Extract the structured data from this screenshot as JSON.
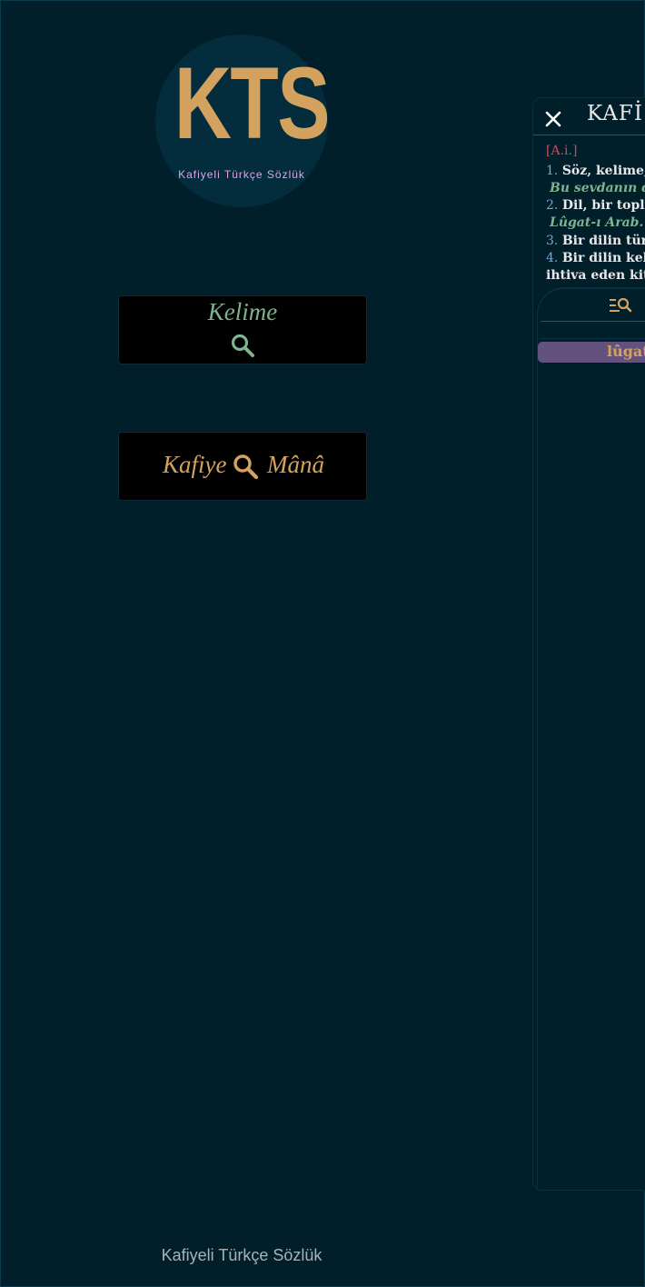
{
  "logo": {
    "mark": "KTS",
    "subtitle": "Kafiyeli Türkçe Sözlük"
  },
  "buttons": {
    "kelime": {
      "label": "Kelime",
      "icon": "search-icon"
    },
    "kafiye": {
      "left_label": "Kafiye",
      "right_label": "Mânâ",
      "icon": "search-icon"
    }
  },
  "footer": {
    "text": "Kafiyeli Türkçe Sözlük"
  },
  "panel": {
    "close_icon": "close-icon",
    "title": "KAFİ",
    "pos": "[A.i.]",
    "definitions": [
      {
        "num": "1.",
        "text": "Söz, kelime,"
      },
      {
        "example": "Bu sevdanın d"
      },
      {
        "num": "2.",
        "text": "Dil, bir toplu"
      },
      {
        "example": "Lûgat-ı Arab."
      },
      {
        "num": "3.",
        "text": "Bir dilin tür"
      },
      {
        "num": "4.",
        "text": "Bir dilin kel"
      },
      {
        "text": "ihtiva eden kita"
      }
    ],
    "list_icon": "list-search-icon",
    "result": "lûgat"
  },
  "colors": {
    "background": "#011e2b",
    "gold": "#d4a25f",
    "green": "#7fb38e",
    "purple": "#64527e",
    "pink": "#d9a6e8",
    "red": "#c64b5c"
  }
}
